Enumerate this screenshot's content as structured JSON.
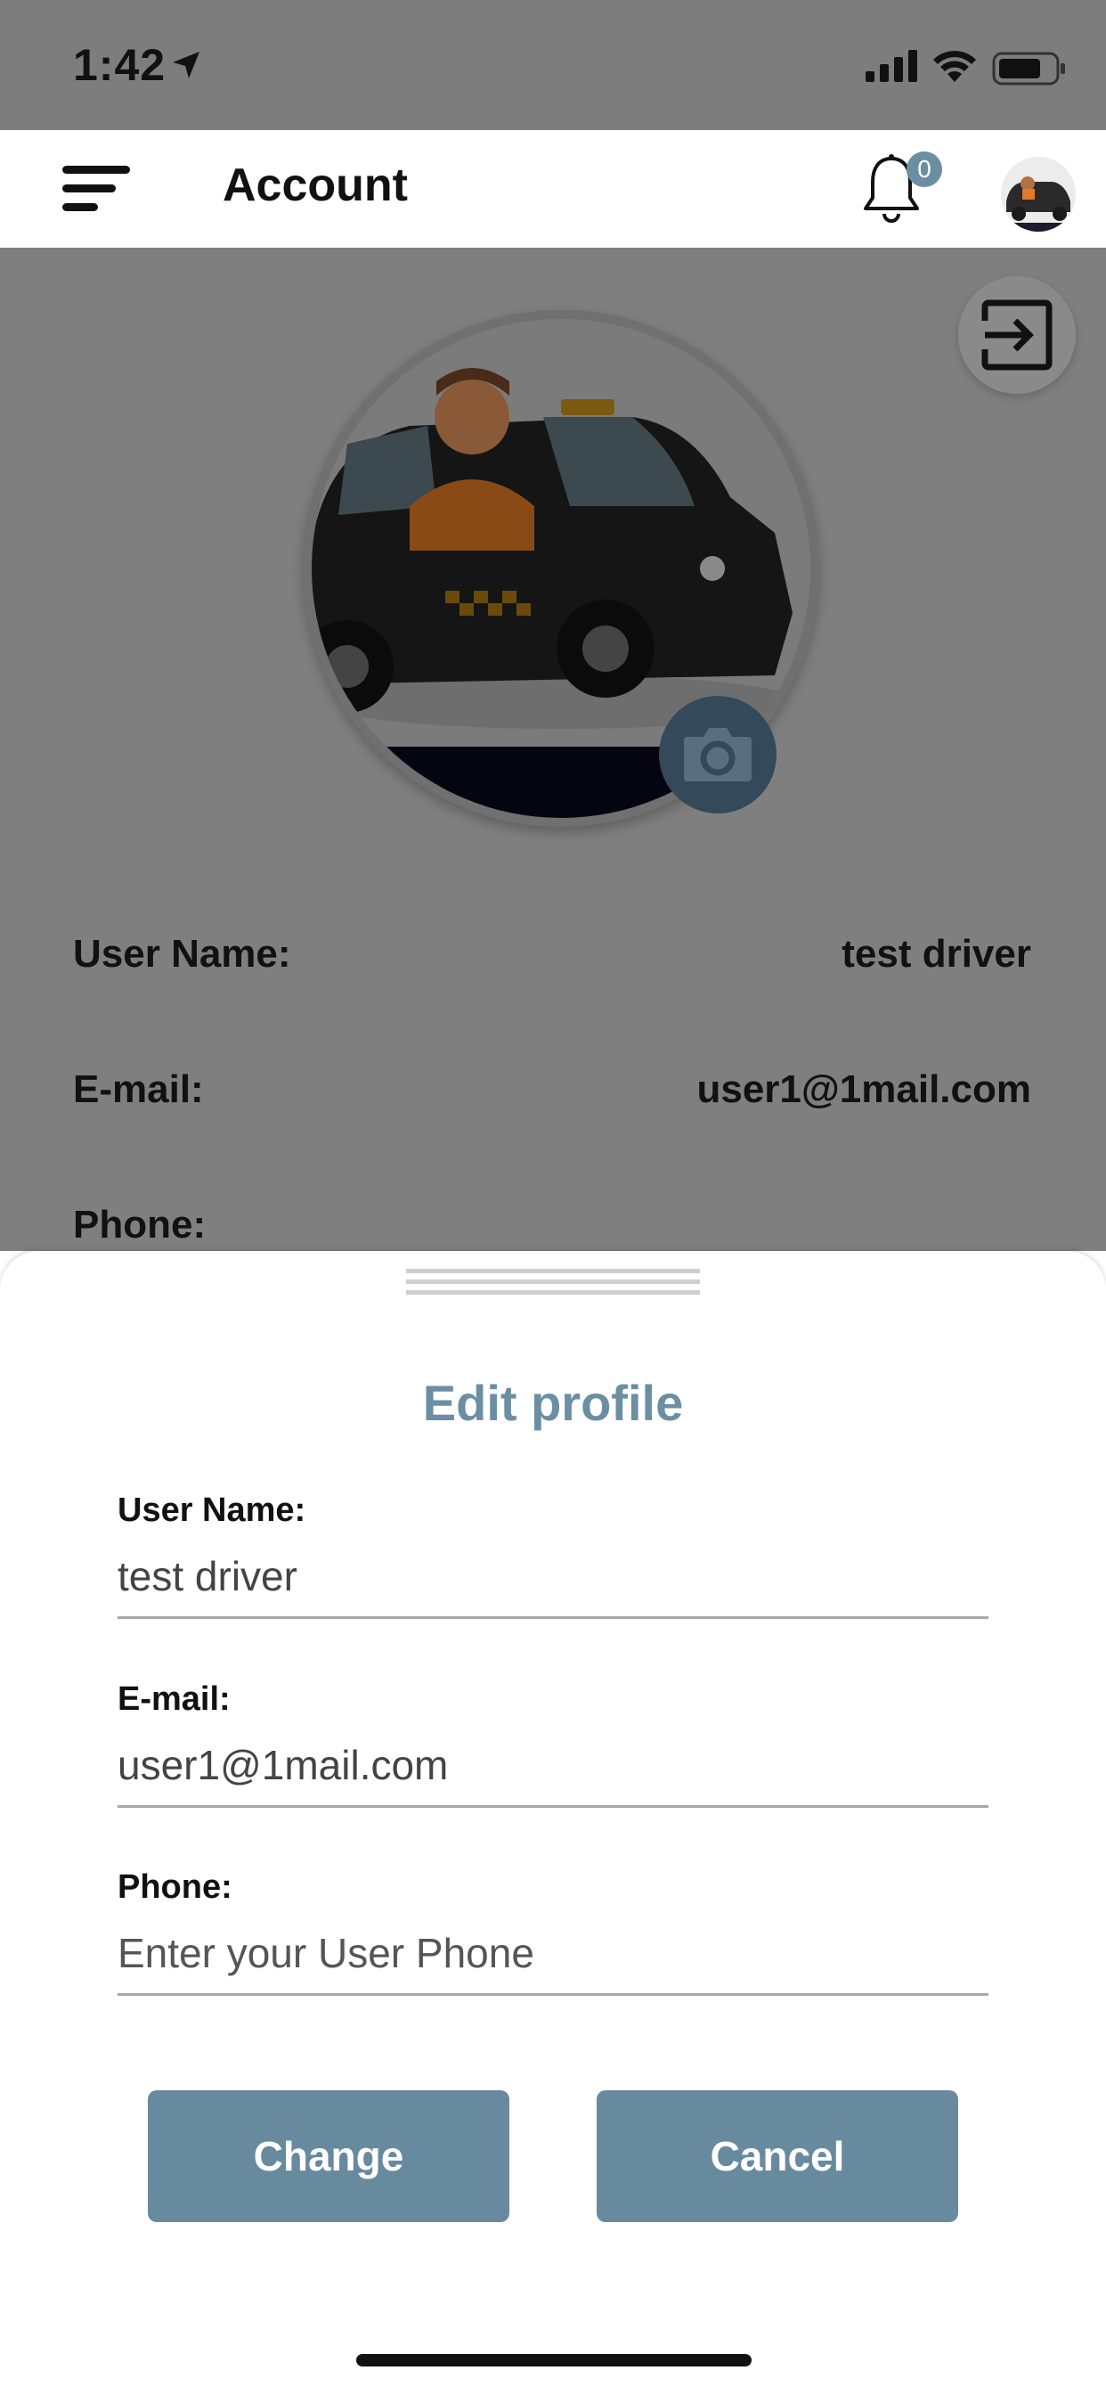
{
  "status_bar": {
    "time": "1:42"
  },
  "header": {
    "title": "Account",
    "notification_count": "0"
  },
  "profile": {
    "rows": [
      {
        "label": "User Name:",
        "value": "test driver"
      },
      {
        "label": "E-mail:",
        "value": "user1@1mail.com"
      },
      {
        "label": "Phone:",
        "value": ""
      }
    ]
  },
  "edit_sheet": {
    "title": "Edit profile",
    "fields": [
      {
        "label": "User Name:",
        "value": "test driver",
        "placeholder": ""
      },
      {
        "label": "E-mail:",
        "value": "user1@1mail.com",
        "placeholder": ""
      },
      {
        "label": "Phone:",
        "value": "",
        "placeholder": "Enter your User Phone"
      }
    ],
    "change_label": "Change",
    "cancel_label": "Cancel"
  },
  "colors": {
    "accent": "#678a9e",
    "title_accent": "#6b8ea3",
    "overlay_dim": "#7f7f7f",
    "camera_button": "#34495a"
  },
  "icons": [
    "menu-icon",
    "bell-icon",
    "logout-icon",
    "camera-icon",
    "location-arrow-icon",
    "signal-icon",
    "wifi-icon",
    "battery-icon"
  ]
}
